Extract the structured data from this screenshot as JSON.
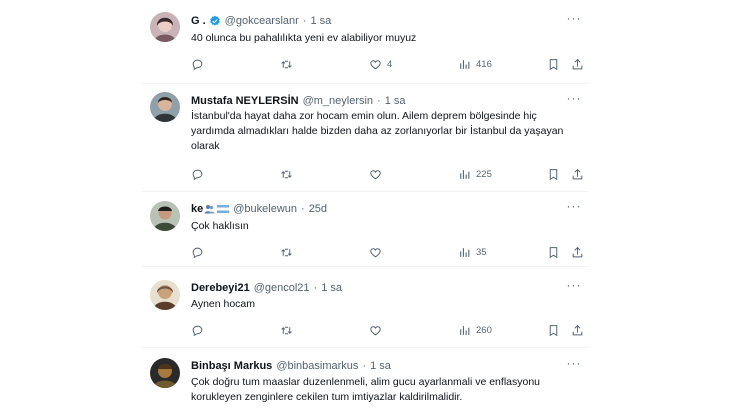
{
  "tweets": [
    {
      "name": "G .",
      "verified": true,
      "handle": "@gokcearslanr",
      "time": "1 sa",
      "text": "40 olunca bu pahalılıkta yeni ev alabiliyor muyuz",
      "replies": "",
      "retweets": "",
      "likes": "4",
      "views": "416"
    },
    {
      "name": "Mustafa NEYLERSİN",
      "verified": false,
      "handle": "@m_neylersin",
      "time": "1 sa",
      "text": "İstanbul'da hayat daha zor hocam emin olun. Ailem deprem bölgesinde hiç yardımda almadıkları halde bizden daha az zorlanıyorlar bir İstanbul da yaşayan olarak",
      "replies": "",
      "retweets": "",
      "likes": "",
      "views": "225"
    },
    {
      "name": "ke",
      "verified": false,
      "handle": "@bukelewun",
      "time": "25d",
      "text": "Çok haklısın",
      "replies": "",
      "retweets": "",
      "likes": "",
      "views": "35"
    },
    {
      "name": "Derebeyi21",
      "verified": false,
      "handle": "@gencol21",
      "time": "1 sa",
      "text": "Aynen hocam",
      "replies": "",
      "retweets": "",
      "likes": "",
      "views": "260"
    },
    {
      "name": "Binbaşı Markus",
      "verified": false,
      "handle": "@binbasimarkus",
      "time": "1 sa",
      "text": "Çok doğru tum maaslar duzenlenmeli, alim gucu ayarlanmali ve enflasyonu korukleyen zenginlere cekilen tum imtiyazlar kaldirilmalidir.",
      "replies": "",
      "retweets": "",
      "likes": "",
      "views": ""
    }
  ],
  "separator": "·",
  "colors": {
    "text": "#0f1419",
    "muted": "#536471",
    "verified": "#1d9bf0",
    "divider": "#eff3f4"
  },
  "icons": [
    "more-icon",
    "reply-icon",
    "retweet-icon",
    "like-icon",
    "views-icon",
    "bookmark-icon",
    "share-icon",
    "verified-badge-icon"
  ]
}
